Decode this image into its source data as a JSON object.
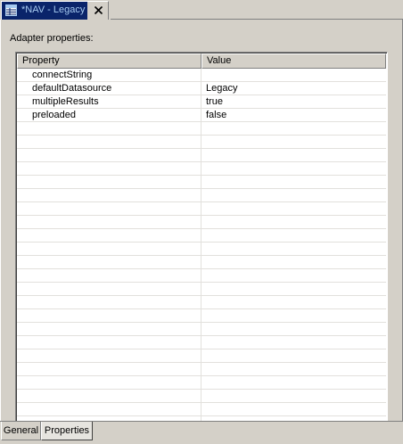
{
  "editor_tab": {
    "title": "*NAV - Legacy",
    "icon": "editor-table-icon",
    "close_icon": "close-icon"
  },
  "panel": {
    "label": "Adapter properties:"
  },
  "table": {
    "columns": [
      "Property",
      "Value"
    ],
    "rows": [
      {
        "property": "connectString",
        "value": ""
      },
      {
        "property": "defaultDatasource",
        "value": "Legacy"
      },
      {
        "property": "multipleResults",
        "value": "true"
      },
      {
        "property": "preloaded",
        "value": "false"
      }
    ]
  },
  "bottom_tabs": [
    "General",
    "Properties"
  ],
  "colors": {
    "active_tab_bg": "#0a246a",
    "active_tab_text": "#a6caf0",
    "window_bg": "#d4d0c8",
    "grid_line": "#e2e0dc"
  }
}
